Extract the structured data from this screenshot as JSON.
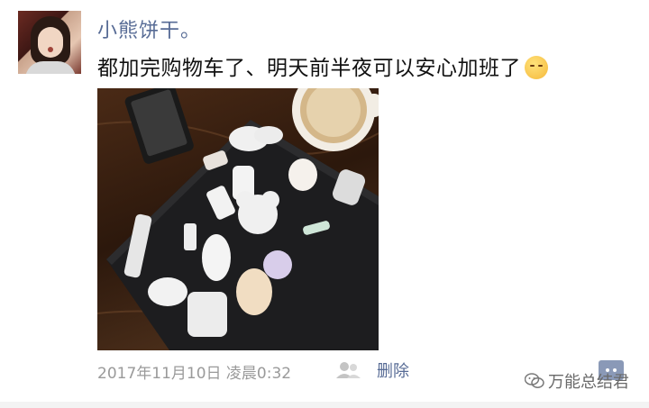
{
  "post": {
    "username": "小熊饼干。",
    "content": "都加完购物车了、明天前半夜可以安心加班了",
    "content_emoji": "sleepy-face-emoji",
    "photo_label": "laptop-with-stickers-photo",
    "timestamp": "2017年11月10日 凌晨0:32",
    "delete_label": "删除",
    "likes_icon": "people-icon",
    "comment_icon": "comment-icon"
  },
  "watermark": {
    "text": "万能总结君",
    "icon": "wechat-icon"
  },
  "colors": {
    "link": "#576b95",
    "meta": "#9a9a9a",
    "text": "#111111"
  }
}
